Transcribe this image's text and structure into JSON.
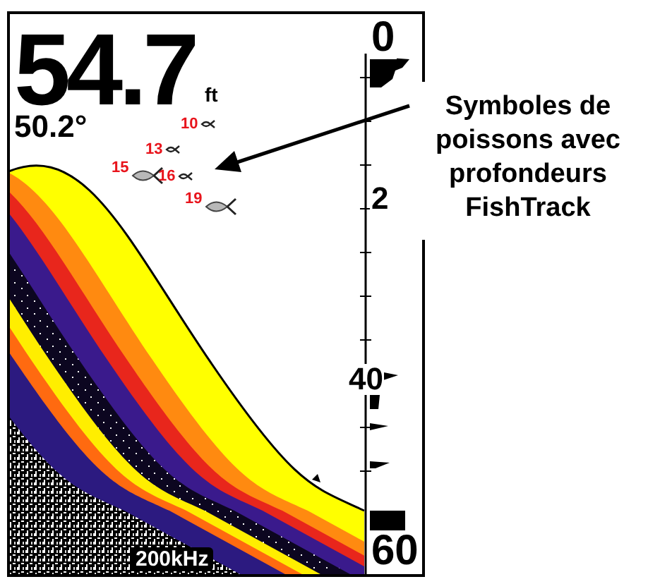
{
  "depth": {
    "value": "54.7",
    "unit": "ft"
  },
  "temperature": "50.2°",
  "fish": [
    {
      "depth": "10",
      "kind": "small"
    },
    {
      "depth": "13",
      "kind": "small"
    },
    {
      "depth": "15",
      "kind": "large"
    },
    {
      "depth": "16",
      "kind": "small"
    },
    {
      "depth": "19",
      "kind": "large"
    }
  ],
  "scale": {
    "labels": [
      "0",
      "2",
      "40",
      "60"
    ]
  },
  "frequency": "200kHz",
  "callout": {
    "text": "Symboles de poissons avec profondeurs FishTrack"
  }
}
